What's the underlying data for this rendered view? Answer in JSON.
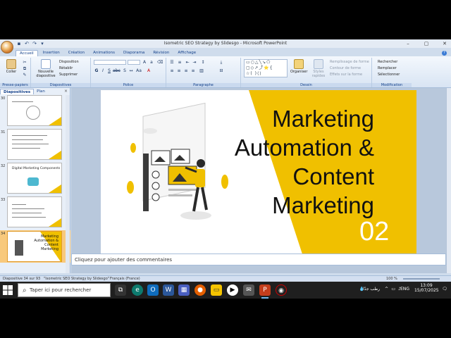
{
  "window": {
    "title": "Isometric SEO Strategy by Slidesgo - Microsoft PowerPoint",
    "controls": [
      "–",
      "▢",
      "✕"
    ]
  },
  "ribbon": {
    "tabs": [
      "Accueil",
      "Insertion",
      "Création",
      "Animations",
      "Diaporama",
      "Révision",
      "Affichage"
    ],
    "active_tab": "Accueil",
    "clipboard": {
      "label": "Presse-papiers",
      "paste": "Coller"
    },
    "slides": {
      "label": "Diapositives",
      "new_slide": "Nouvelle diapositive",
      "layout": "Disposition",
      "reset": "Rétablir",
      "delete": "Supprimer"
    },
    "font": {
      "label": "Police"
    },
    "paragraph": {
      "label": "Paragraphe"
    },
    "drawing": {
      "label": "Dessin",
      "arrange": "Organiser",
      "quick_styles": "Styles rapides",
      "fill": "Remplissage de forme",
      "outline": "Contour de forme",
      "effects": "Effets sur la forme"
    },
    "editing": {
      "label": "Modification",
      "find": "Rechercher",
      "replace": "Remplacer",
      "select": "Sélectionner"
    }
  },
  "pane": {
    "tabs": [
      "Diapositives",
      "Plan"
    ],
    "close": "×",
    "slides": [
      {
        "num": "30",
        "title": ""
      },
      {
        "num": "31",
        "title": ""
      },
      {
        "num": "32",
        "title": "Digital Marketing Components"
      },
      {
        "num": "33",
        "title": ""
      },
      {
        "num": "34",
        "title": "Marketing Automation & Content Marketing"
      }
    ]
  },
  "slide": {
    "title": "Marketing Automation & Content Marketing",
    "number": "02",
    "accent": "#f0c000"
  },
  "notes": {
    "placeholder": "Cliquez pour ajouter des commentaires"
  },
  "status": {
    "position": "Diapositive 34 sur 93",
    "theme": "\"Isometric SEO Strategy by Slidesgo\"",
    "language": "Français (France)",
    "zoom": "100 %"
  },
  "taskbar": {
    "search_placeholder": "Taper ici pour rechercher",
    "weather": "رطب جدًا",
    "lang": "ENG",
    "time": "13:09",
    "date": "15/07/2025"
  }
}
